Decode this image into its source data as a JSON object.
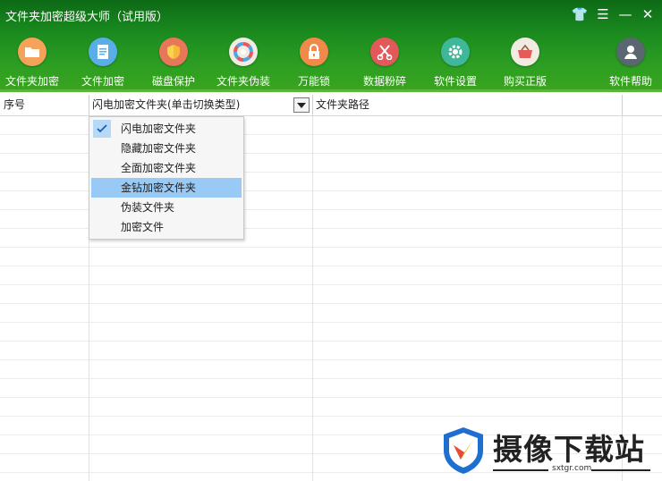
{
  "window": {
    "title": "文件夹加密超级大师（试用版）"
  },
  "window_controls": [
    {
      "name": "skin-button",
      "glyph": "👕"
    },
    {
      "name": "menu-button",
      "glyph": "☰"
    },
    {
      "name": "minimize-button",
      "glyph": "—"
    },
    {
      "name": "close-button",
      "glyph": "✕"
    }
  ],
  "toolbar": [
    {
      "label": "文件夹加密",
      "icon": "folder-icon",
      "color": "#f5a35a"
    },
    {
      "label": "文件加密",
      "icon": "document-icon",
      "color": "#5aaee8"
    },
    {
      "label": "磁盘保护",
      "icon": "shield-icon",
      "color": "#e8775a"
    },
    {
      "label": "文件夹伪装",
      "icon": "color-wheel-icon",
      "color": "#f0ece2"
    },
    {
      "label": "万能锁",
      "icon": "lock-icon",
      "color": "#f08a4a"
    },
    {
      "label": "数据粉碎",
      "icon": "scissors-icon",
      "color": "#e35858"
    },
    {
      "label": "软件设置",
      "icon": "gear-icon",
      "color": "#3fb89a"
    },
    {
      "label": "购买正版",
      "icon": "basket-icon",
      "color": "#f0ece2"
    },
    {
      "label": "软件帮助",
      "icon": "user-icon",
      "color": "#5a6670"
    }
  ],
  "table": {
    "columns": [
      "序号",
      "闪电加密文件夹(单击切换类型)",
      "文件夹路径"
    ]
  },
  "dropdown": {
    "selected_index": 0,
    "highlighted_index": 3,
    "items": [
      "闪电加密文件夹",
      "隐藏加密文件夹",
      "全面加密文件夹",
      "金钻加密文件夹",
      "伪装文件夹",
      "加密文件"
    ]
  },
  "watermark": {
    "name": "摄像下载站",
    "url": "sxtgr.com"
  }
}
